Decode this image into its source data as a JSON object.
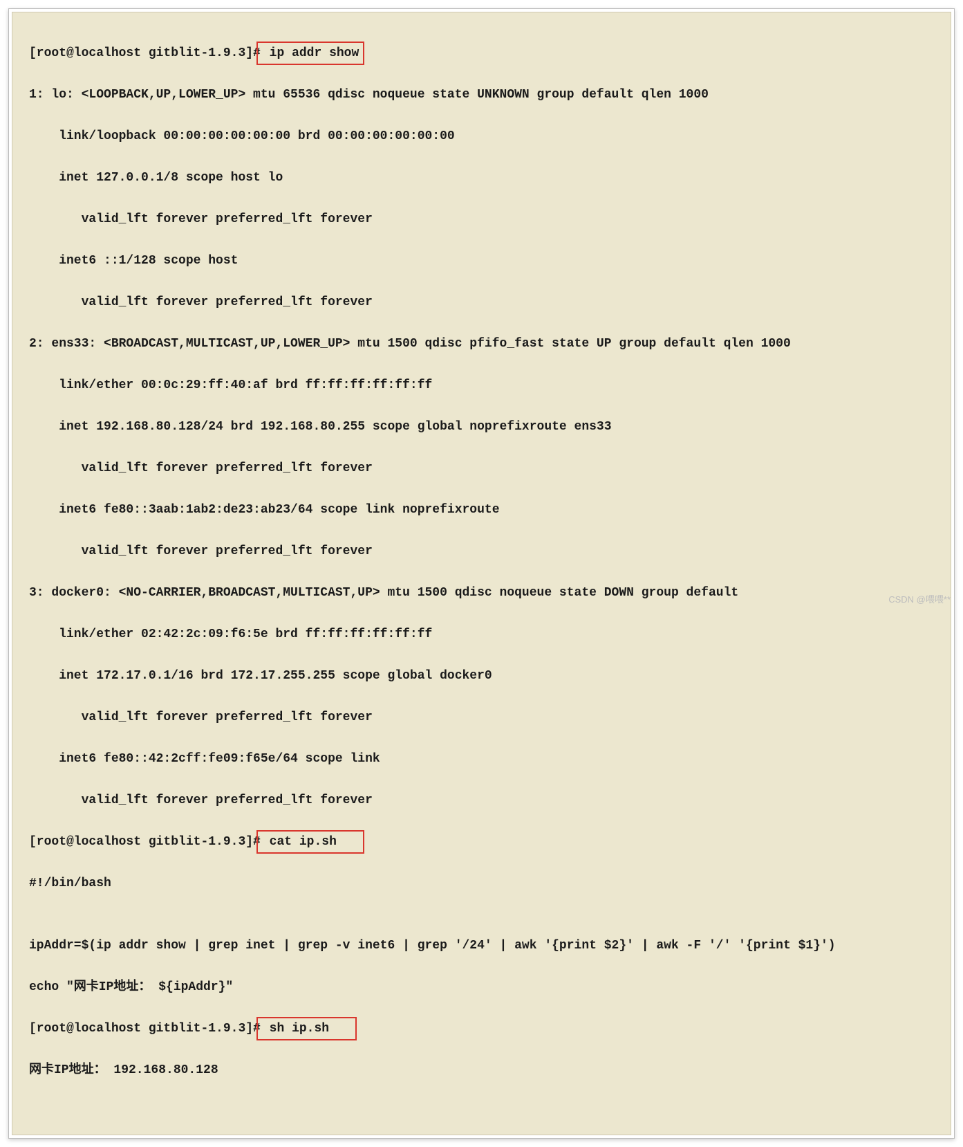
{
  "prompt1_prefix": "[root@localhost gitblit-1.9.3]#",
  "cmd1": " ip addr show",
  "output_ipaddr": [
    "1: lo: <LOOPBACK,UP,LOWER_UP> mtu 65536 qdisc noqueue state UNKNOWN group default qlen 1000",
    "    link/loopback 00:00:00:00:00:00 brd 00:00:00:00:00:00",
    "    inet 127.0.0.1/8 scope host lo",
    "       valid_lft forever preferred_lft forever",
    "    inet6 ::1/128 scope host ",
    "       valid_lft forever preferred_lft forever",
    "2: ens33: <BROADCAST,MULTICAST,UP,LOWER_UP> mtu 1500 qdisc pfifo_fast state UP group default qlen 1000",
    "    link/ether 00:0c:29:ff:40:af brd ff:ff:ff:ff:ff:ff",
    "    inet 192.168.80.128/24 brd 192.168.80.255 scope global noprefixroute ens33",
    "       valid_lft forever preferred_lft forever",
    "    inet6 fe80::3aab:1ab2:de23:ab23/64 scope link noprefixroute ",
    "       valid_lft forever preferred_lft forever",
    "3: docker0: <NO-CARRIER,BROADCAST,MULTICAST,UP> mtu 1500 qdisc noqueue state DOWN group default ",
    "    link/ether 02:42:2c:09:f6:5e brd ff:ff:ff:ff:ff:ff",
    "    inet 172.17.0.1/16 brd 172.17.255.255 scope global docker0",
    "       valid_lft forever preferred_lft forever",
    "    inet6 fe80::42:2cff:fe09:f65e/64 scope link ",
    "       valid_lft forever preferred_lft forever"
  ],
  "prompt2_prefix": "[root@localhost gitblit-1.9.3]#",
  "cmd2": " cat ip.sh   ",
  "script_content": [
    "#!/bin/bash",
    "",
    "ipAddr=$(ip addr show | grep inet | grep -v inet6 | grep '/24' | awk '{print $2}' | awk -F '/' '{print $1}')",
    "echo \"网卡IP地址： ${ipAddr}\""
  ],
  "prompt3_prefix": "[root@localhost gitblit-1.9.3]#",
  "cmd3": " sh ip.sh   ",
  "script_output": "网卡IP地址： 192.168.80.128",
  "watermark": "CSDN @喂喂**"
}
